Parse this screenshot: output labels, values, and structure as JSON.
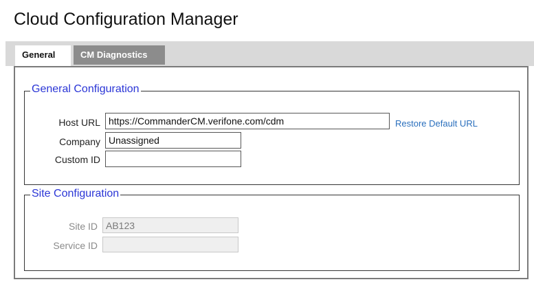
{
  "window": {
    "title": "Cloud Configuration Manager"
  },
  "tabs": [
    {
      "label": "General",
      "active": true
    },
    {
      "label": "CM Diagnostics",
      "active": false
    }
  ],
  "general_configuration": {
    "legend": "General Configuration",
    "host_url": {
      "label": "Host URL",
      "value": "https://CommanderCM.verifone.com/cdm"
    },
    "restore_link": "Restore Default URL",
    "company": {
      "label": "Company",
      "value": "Unassigned"
    },
    "custom_id": {
      "label": "Custom ID",
      "value": ""
    }
  },
  "site_configuration": {
    "legend": "Site Configuration",
    "site_id": {
      "label": "Site ID",
      "value": "AB123"
    },
    "service_id": {
      "label": "Service ID",
      "value": ""
    }
  },
  "colors": {
    "legend_text": "#2a35d6",
    "link": "#2a6fbd",
    "inactive_tab": "#8c8c8c",
    "tab_bar": "#d9d9d9"
  }
}
